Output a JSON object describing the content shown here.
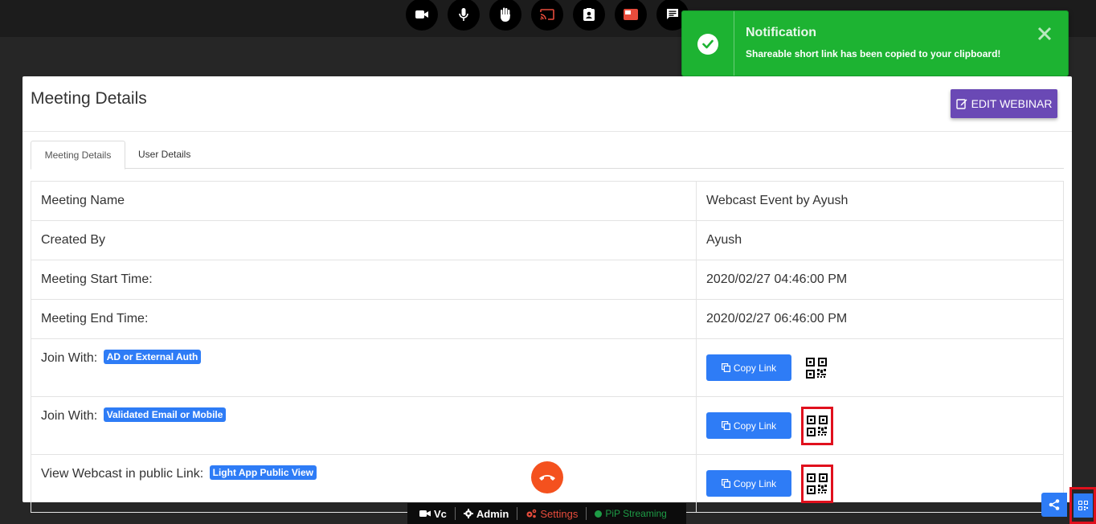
{
  "toolbar": {
    "buttons": [
      {
        "icon": "video-camera-icon"
      },
      {
        "icon": "microphone-icon"
      },
      {
        "icon": "raise-hand-icon"
      },
      {
        "icon": "cast-icon"
      },
      {
        "icon": "contact-card-icon"
      },
      {
        "icon": "screen-layout-icon"
      },
      {
        "icon": "chat-icon"
      }
    ]
  },
  "notification": {
    "title": "Notification",
    "message": "Shareable short link has been copied to your clipboard!",
    "color": "#1db332"
  },
  "panel": {
    "title": "Meeting Details",
    "edit_button": "EDIT WEBINAR",
    "tabs": [
      {
        "label": "Meeting Details",
        "active": true
      },
      {
        "label": "User Details",
        "active": false
      }
    ],
    "rows": [
      {
        "label": "Meeting Name",
        "value": "Webcast Event by Ayush"
      },
      {
        "label": "Created By",
        "value": "Ayush"
      },
      {
        "label": "Meeting Start Time:",
        "value": "2020/02/27 04:46:00 PM"
      },
      {
        "label": "Meeting End Time:",
        "value": "2020/02/27 06:46:00 PM"
      }
    ],
    "link_rows": [
      {
        "label": "Join With:",
        "badge": "AD or External Auth",
        "button": "Copy Link",
        "qr_icon": "qr-code-icon"
      },
      {
        "label": "Join With:",
        "badge": "Validated Email or Mobile",
        "button": "Copy Link",
        "qr_icon": "qr-code-icon"
      },
      {
        "label": "View Webcast in public Link:",
        "badge": "Light App Public View",
        "button": "Copy Link",
        "qr_icon": "qr-code-icon"
      }
    ]
  },
  "bottom_bar": {
    "vc": "Vc",
    "admin": "Admin",
    "settings": "Settings",
    "pip": "PiP Streaming"
  },
  "colors": {
    "accent_blue": "#2e7cf6",
    "edit_purple": "#6a49b5",
    "hangup_orange": "#f4511e",
    "highlight_red": "#e0101d",
    "pip_green": "#1e9c46"
  }
}
